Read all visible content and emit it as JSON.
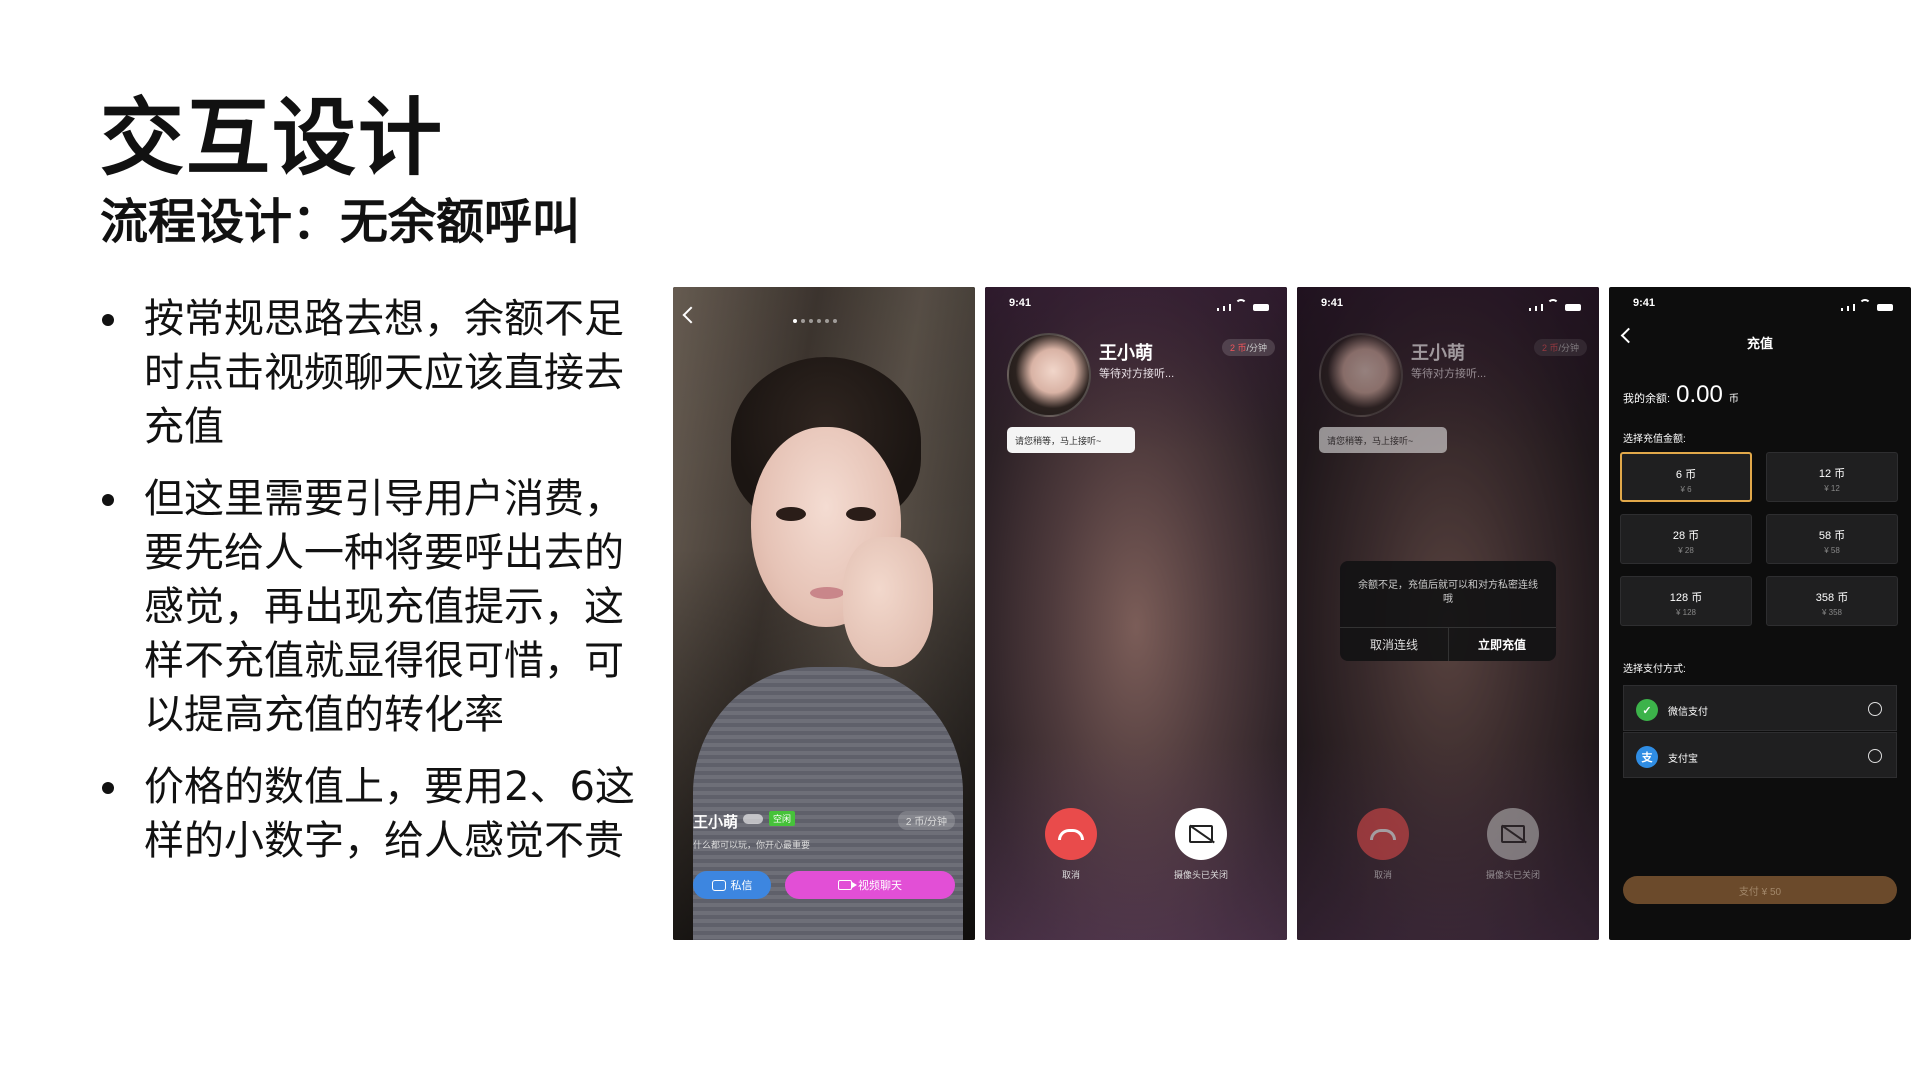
{
  "slide": {
    "title": "交互设计",
    "subtitle": "流程设计：无余额呼叫",
    "bullets": [
      "按常规思路去想，余额不足时点击视频聊天应该直接去充值",
      "但这里需要引导用户消费，要先给人一种将要呼出去的感觉，再出现充值提示，这样不充值就显得很可惜，可以提高充值的转化率",
      "价格的数值上，要用2、6这样的小数字，给人感觉不贵"
    ]
  },
  "profile": {
    "name": "王小萌",
    "status": "空闲",
    "rate": "2 币/分钟",
    "bio": "什么都可以玩，你开心最重要",
    "message_button": "私信",
    "video_button": "视频聊天"
  },
  "call": {
    "time": "9:41",
    "name": "王小萌",
    "waiting": "等待对方接听...",
    "rate_value": "2 币",
    "rate_unit": "/分钟",
    "tip": "请您稍等，马上接听~",
    "cancel_label": "取消",
    "camera_label": "摄像头已关闭"
  },
  "dialog": {
    "message": "余额不足，充值后就可以和对方私密连线哦",
    "cancel": "取消连线",
    "confirm": "立即充值"
  },
  "recharge": {
    "time": "9:41",
    "title": "充值",
    "balance_label": "我的余额:",
    "balance": "0.00",
    "balance_unit": "币",
    "amount_section": "选择充值金额:",
    "packages": [
      {
        "coins": "6 币",
        "price": "¥ 6"
      },
      {
        "coins": "12 币",
        "price": "¥ 12"
      },
      {
        "coins": "28 币",
        "price": "¥ 28"
      },
      {
        "coins": "58 币",
        "price": "¥ 58"
      },
      {
        "coins": "128 币",
        "price": "¥ 128"
      },
      {
        "coins": "358 币",
        "price": "¥ 358"
      }
    ],
    "payment_section": "选择支付方式:",
    "payments": [
      {
        "label": "微信支付",
        "color": "#3cb34a"
      },
      {
        "label": "支付宝",
        "color": "#2f8de4"
      }
    ],
    "pay_button": "支付 ¥ 50"
  },
  "colors": {
    "accent_gold": "#e1a84a",
    "hangup_red": "#e94b4b",
    "video_pink": "#e24fd6",
    "message_blue": "#3d86e0"
  }
}
